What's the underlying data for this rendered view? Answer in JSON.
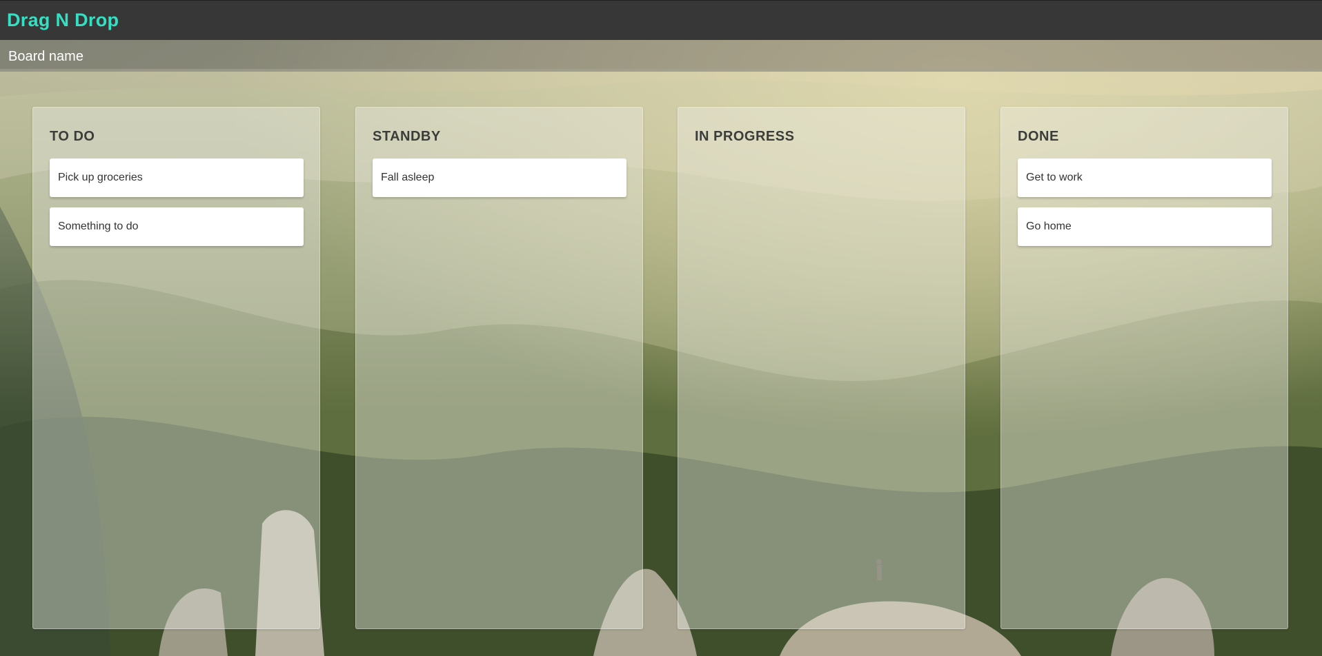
{
  "header": {
    "app_title": "Drag N Drop",
    "accent_color": "#33e0c4",
    "bar_color": "#373737"
  },
  "board": {
    "name": "Board name",
    "columns": [
      {
        "title": "TO DO",
        "cards": [
          "Pick up groceries",
          "Something to do"
        ]
      },
      {
        "title": "STANDBY",
        "cards": [
          "Fall asleep"
        ]
      },
      {
        "title": "IN PROGRESS",
        "cards": []
      },
      {
        "title": "DONE",
        "cards": [
          "Get to work",
          "Go home"
        ]
      }
    ]
  }
}
